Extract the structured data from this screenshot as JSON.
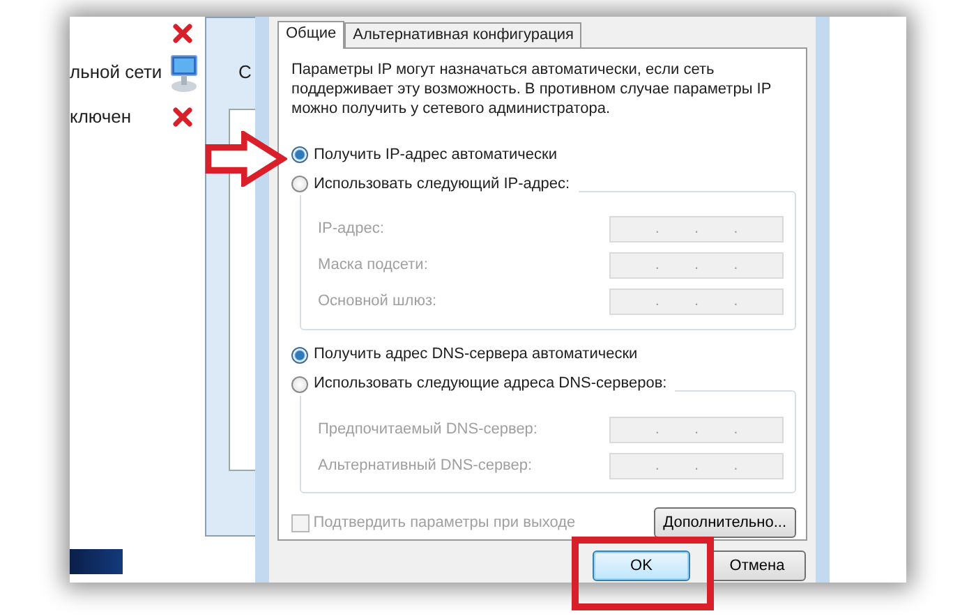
{
  "background_window": {
    "cut_letter": "С",
    "items": [
      {
        "label": "льной сети"
      },
      {
        "label": "ключен"
      }
    ]
  },
  "dialog": {
    "tabs": [
      {
        "label": "Общие",
        "selected": true
      },
      {
        "label": "Альтернативная конфигурация",
        "selected": false
      }
    ],
    "description": "Параметры IP могут назначаться автоматически, если сеть поддерживает эту возможность. В противном случае параметры IP можно получить у сетевого администратора.",
    "ip_mode": [
      {
        "label": "Получить IP-адрес автоматически",
        "selected": true
      },
      {
        "label": "Использовать следующий IP-адрес:",
        "selected": false
      }
    ],
    "ip_fields": [
      {
        "label": "IP-адрес:",
        "value": ". . .",
        "disabled": true
      },
      {
        "label": "Маска подсети:",
        "value": ". . .",
        "disabled": true
      },
      {
        "label": "Основной шлюз:",
        "value": ". . .",
        "disabled": true
      }
    ],
    "dns_mode": [
      {
        "label": "Получить адрес DNS-сервера автоматически",
        "selected": true
      },
      {
        "label": "Использовать следующие адреса DNS-серверов:",
        "selected": false
      }
    ],
    "dns_fields": [
      {
        "label": "Предпочитаемый DNS-сервер:",
        "value": ". . .",
        "disabled": true
      },
      {
        "label": "Альтернативный DNS-сервер:",
        "value": ". . .",
        "disabled": true
      }
    ],
    "validate": {
      "label": "Подтвердить параметры при выходе",
      "checked": false,
      "disabled": true
    },
    "advanced_button": "Дополнительно...",
    "buttons": [
      {
        "label": "OK",
        "default": true
      },
      {
        "label": "Отмена",
        "default": false
      }
    ]
  }
}
